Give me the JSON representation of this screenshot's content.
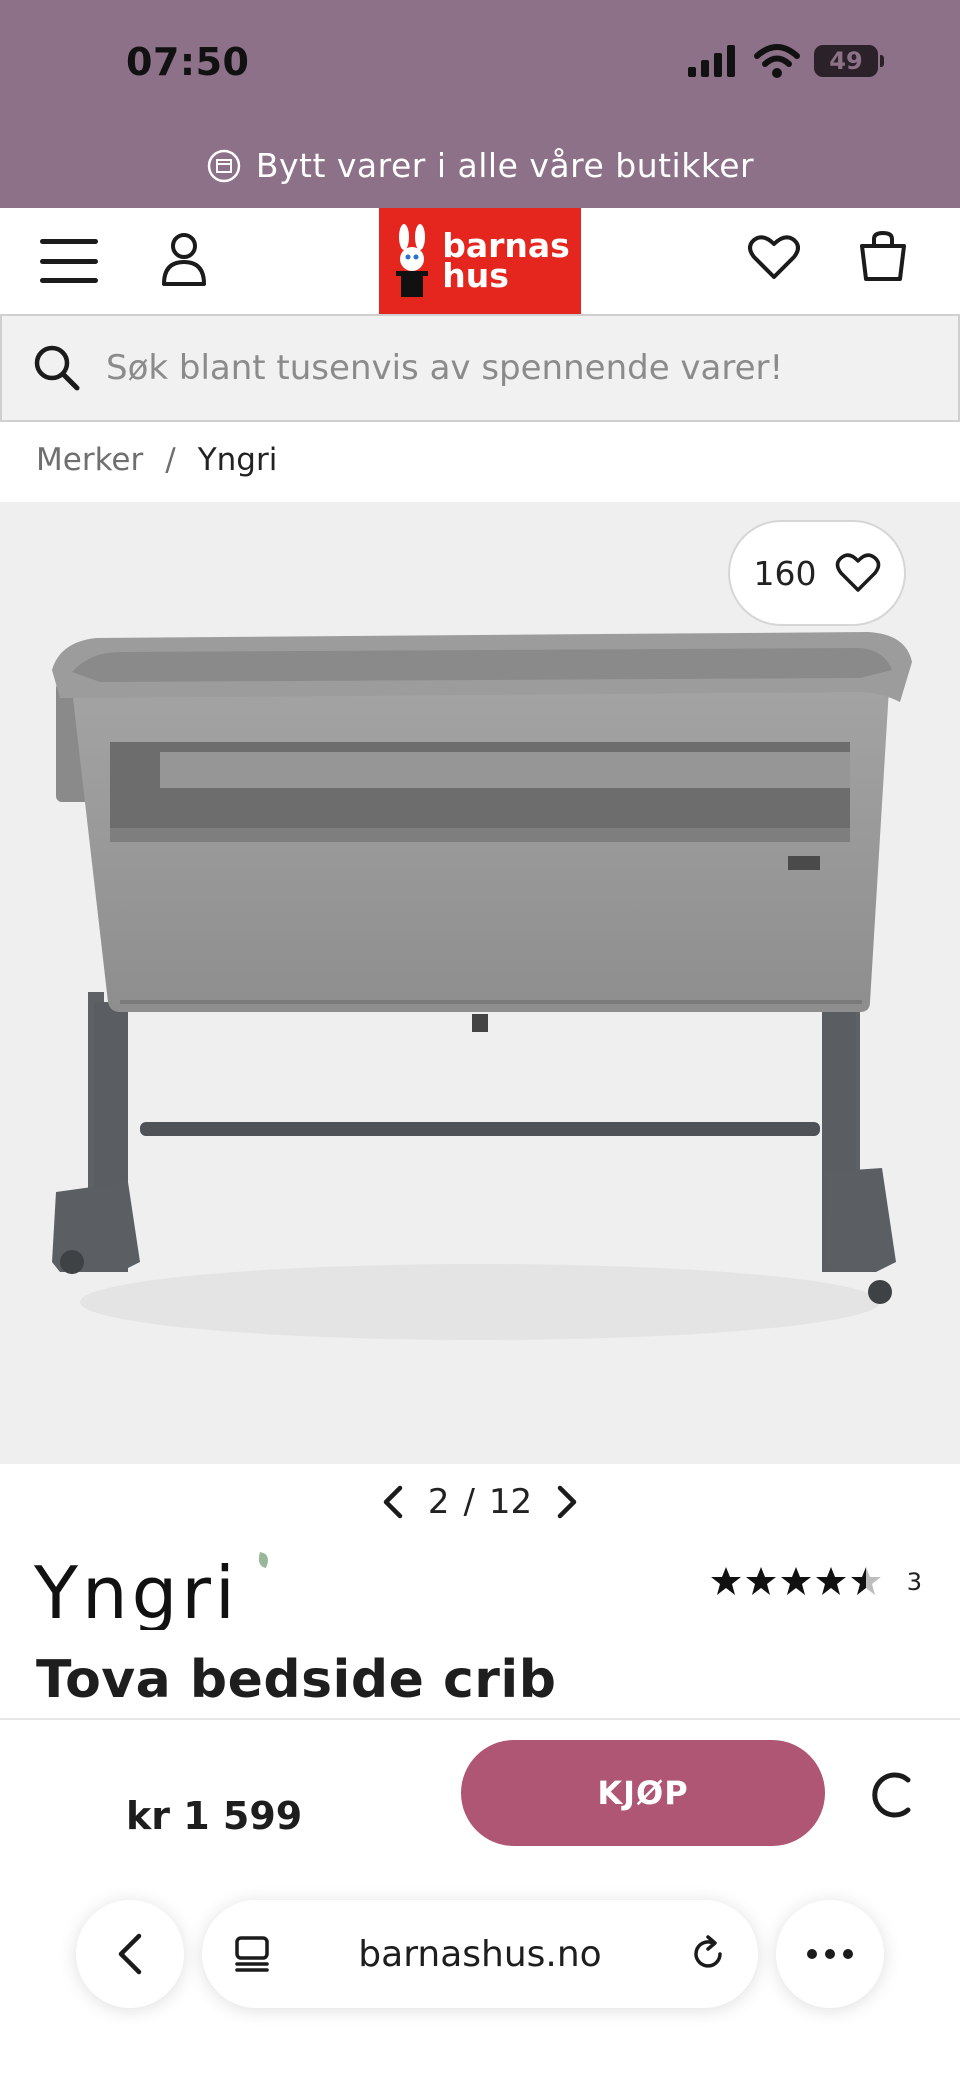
{
  "status_bar": {
    "time": "07:50",
    "battery": "49"
  },
  "promo": {
    "text": "Bytt varer i alle våre butikker"
  },
  "header": {
    "logo_text_line1": "barnas",
    "logo_text_line2": "hus"
  },
  "search": {
    "placeholder": "Søk blant tusenvis av spennende varer!"
  },
  "breadcrumb": {
    "items": [
      "Merker",
      "Yngri"
    ],
    "separator": "/"
  },
  "gallery": {
    "favorite_count": "160",
    "current": "2",
    "separator": "/",
    "total": "12"
  },
  "product": {
    "brand": "Yngri",
    "title": "Tova bedside crib",
    "rating": 4.5,
    "review_count": "3",
    "price": "kr 1 599",
    "buy_label": "KJØP"
  },
  "browser": {
    "url": "barnashus.no"
  },
  "colors": {
    "header_band": "#8c7188",
    "logo_red": "#e4261f",
    "buy_button": "#b05675"
  }
}
